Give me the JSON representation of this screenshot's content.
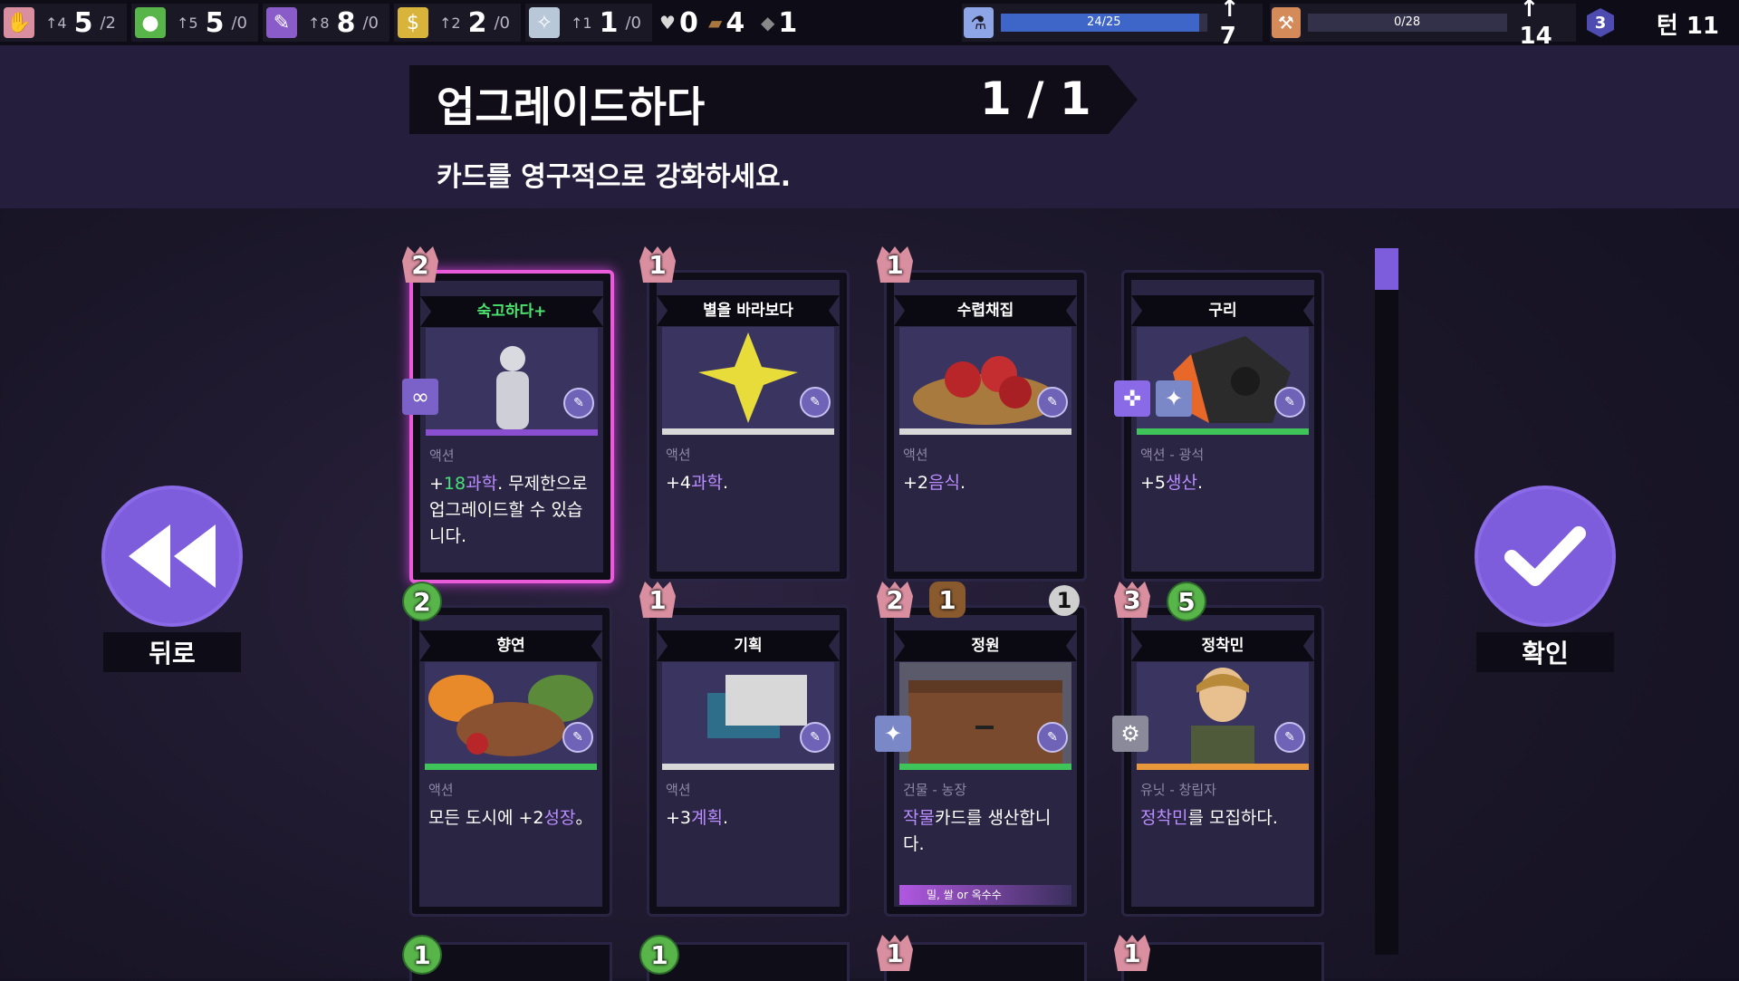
{
  "topbar": {
    "hand": {
      "icon": "hand-icon",
      "color": "#d98f9f",
      "small": "↑4",
      "big": "5",
      "div": "/2"
    },
    "food": {
      "icon": "apple-icon",
      "color": "#58b54a",
      "small": "↑5",
      "big": "5",
      "div": "/0"
    },
    "plan": {
      "icon": "feather-icon",
      "color": "#8a5cc9",
      "small": "↑8",
      "big": "8",
      "div": "/0"
    },
    "gold": {
      "icon": "money-bag-icon",
      "color": "#d8b53a",
      "small": "↑2",
      "big": "2",
      "div": "/0"
    },
    "faith": {
      "icon": "dove-icon",
      "color": "#b8c8d8",
      "small": "↑1",
      "big": "1",
      "div": "/0"
    },
    "gems": "0",
    "wood": "4",
    "stone": "1",
    "science": {
      "icon": "flask-icon",
      "label": "24/25",
      "fill": 0.96,
      "up": "↑ 7",
      "color": "#3e66c8"
    },
    "production": {
      "icon": "hammer-icon",
      "label": "0/28",
      "fill": 0.0,
      "up": "↑ 14",
      "color": "#a0663a"
    },
    "hex_badge": "3",
    "turn": "턴 11"
  },
  "header": {
    "title": "업그레이드하다",
    "count": "1 / 1",
    "subtitle": "카드를 영구적으로 강화하세요."
  },
  "buttons": {
    "back": "뒤로",
    "confirm": "확인"
  },
  "cards": [
    {
      "name": "숙고하다+",
      "cost": "2",
      "costType": "hand",
      "type": "액션",
      "stripe": "#8a4fd0",
      "selected": true,
      "desc_parts": [
        "+",
        "18",
        "과학",
        ". 무제한으로 업그레이드할 수 있습니다."
      ],
      "sideBadge": "∞",
      "sideColor": "#7b62c9",
      "art": "thinker-statue"
    },
    {
      "name": "별을 바라보다",
      "cost": "1",
      "costType": "hand",
      "type": "액션",
      "stripe": "#d8d8d8",
      "desc_parts": [
        "+4",
        "과학",
        "."
      ],
      "art": "star"
    },
    {
      "name": "수렵채집",
      "cost": "1",
      "costType": "hand",
      "type": "액션",
      "stripe": "#d8d8d8",
      "desc_parts": [
        "+2",
        "음식",
        "."
      ],
      "art": "apple-basket"
    },
    {
      "name": "구리",
      "cost": "",
      "costType": "",
      "type": "액션 - 광석",
      "stripe": "#3fc45a",
      "desc_parts": [
        "+5",
        "생산",
        "."
      ],
      "art": "copper-ore"
    },
    {
      "name": "향연",
      "cost": "2",
      "costType": "apple",
      "type": "액션",
      "stripe": "#3fc45a",
      "desc_parts": [
        "모든 도시에 +2",
        "성장",
        "。"
      ],
      "art": "feast"
    },
    {
      "name": "기획",
      "cost": "1",
      "costType": "hand",
      "type": "액션",
      "stripe": "#d8d8d8",
      "desc_parts": [
        "+3",
        "계획",
        "."
      ],
      "art": "speech-bubbles"
    },
    {
      "name": "정원",
      "cost": "2",
      "costType": "hand",
      "type": "건물 - 농장",
      "stripe": "#3fc45a",
      "desc_parts": [
        "작물",
        "카드를 생산합니다."
      ],
      "art": "wooden-shed",
      "extra_cost": "1",
      "gear": "1",
      "req": "밀, 쌀 or 옥수수"
    },
    {
      "name": "정착민",
      "cost": "3",
      "costType": "hand",
      "type": "유닛 - 창립자",
      "stripe": "#e8973a",
      "desc_parts": [
        "정착민",
        "를 모집하다."
      ],
      "art": "settler",
      "extra_cost": "5"
    }
  ],
  "bottom_row_costs": [
    {
      "cost": "1",
      "costType": "apple"
    },
    {
      "cost": "1",
      "costType": "apple"
    },
    {
      "cost": "1",
      "costType": "hand"
    },
    {
      "cost": "1",
      "costType": "hand"
    }
  ]
}
